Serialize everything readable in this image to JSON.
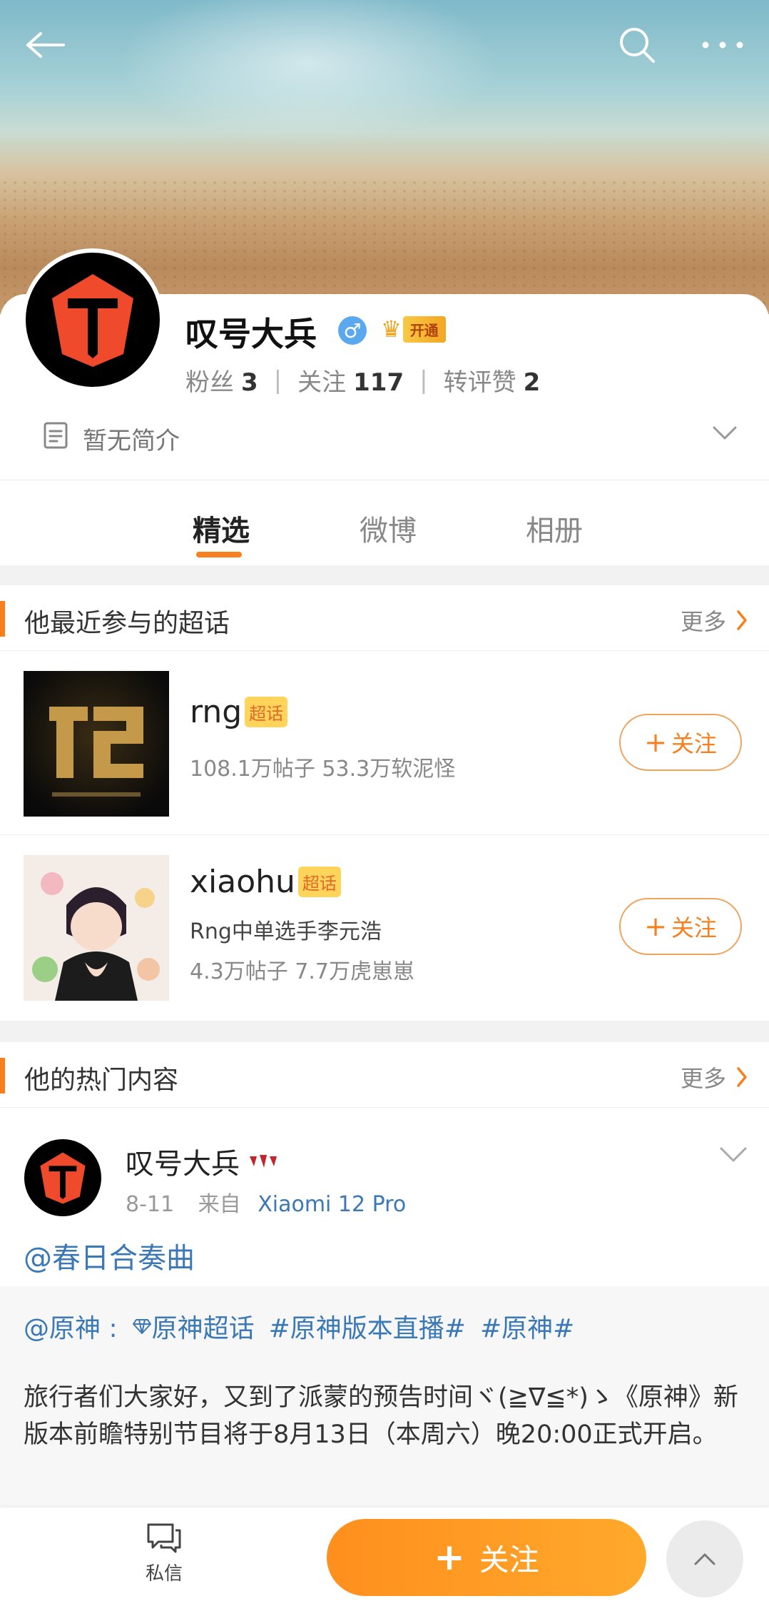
{
  "profile": {
    "name": "叹号大兵",
    "vip_label": "开通",
    "stats": [
      {
        "label": "粉丝",
        "value": "3"
      },
      {
        "label": "关注",
        "value": "117"
      },
      {
        "label": "转评赞",
        "value": "2"
      }
    ],
    "bio": "暂无简介"
  },
  "tabs": [
    {
      "label": "精选",
      "active": true
    },
    {
      "label": "微博",
      "active": false
    },
    {
      "label": "相册",
      "active": false
    }
  ],
  "super_topics": {
    "title": "他最近参与的超话",
    "more_label": "更多",
    "badge": "超话",
    "follow_label": "关注",
    "items": [
      {
        "name": "rng",
        "lines": [
          "108.1万帖子 53.3万软泥怪"
        ]
      },
      {
        "name": "xiaohu",
        "lines": [
          "Rng中单选手李元浩",
          "4.3万帖子 7.7万虎崽崽"
        ]
      }
    ]
  },
  "hot": {
    "title": "他的热门内容",
    "more_label": "更多",
    "post": {
      "author": "叹号大兵",
      "date": "8-11",
      "from_label": "来自",
      "source": "Xiaomi 12 Pro",
      "text": "@春日合奏曲",
      "repost_tags": [
        "@原神 :",
        "原神超话",
        "#原神版本直播#",
        "#原神#"
      ],
      "repost_body": "旅行者们大家好，又到了派蒙的预告时间ヾ(≧∇≦*)ゝ《原神》新版本前瞻特别节目将于8月13日（本周六）晚20:00正式开启。"
    }
  },
  "bottom": {
    "dm_label": "私信",
    "follow_label": "关注"
  },
  "colors": {
    "accent": "#f77f1d",
    "link": "#3a78b6",
    "badge": "#ffd45a"
  }
}
